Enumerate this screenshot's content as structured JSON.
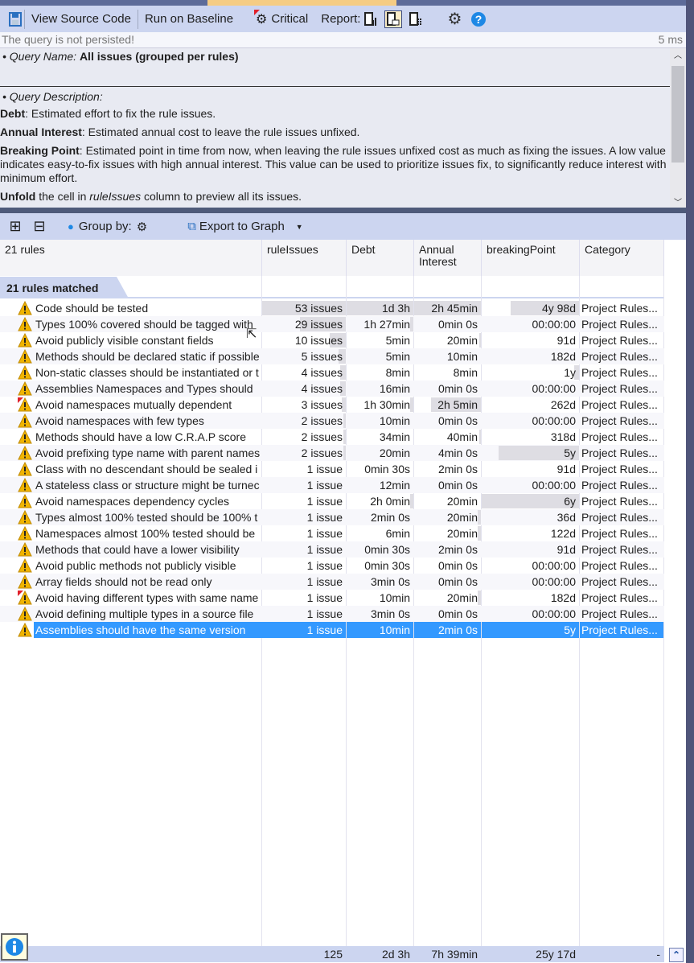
{
  "toolbar": {
    "view_source": "View Source Code",
    "run_baseline": "Run on Baseline",
    "critical": "Critical",
    "report": "Report:"
  },
  "status": {
    "message": "The query is not persisted!",
    "time": "5 ms"
  },
  "description": {
    "query_name_label": "• Query Name:",
    "query_name": "All issues (grouped per rules)",
    "query_desc_label": "• Query Description:",
    "debt_term": "Debt",
    "debt_text": ": Estimated effort to fix the rule issues.",
    "interest_term": "Annual Interest",
    "interest_text": ": Estimated annual cost to leave the rule issues unfixed.",
    "bp_term": "Breaking Point",
    "bp_text": ": Estimated point in time from now, when leaving the rule issues unfixed cost as much as fixing the issues. A low value indicates easy-to-fix issues with high annual interest. This value can be used to prioritize issues fix, to significantly reduce interest with minimum effort.",
    "unfold_term": "Unfold",
    "unfold_text1": " the cell in ",
    "unfold_col": "ruleIssues",
    "unfold_text2": " column to preview all its issues."
  },
  "grid_toolbar": {
    "group_by": "Group by:",
    "export": "Export to Graph"
  },
  "columns": [
    "21 rules",
    "ruleIssues",
    "Debt",
    "Annual Interest",
    "breakingPoint",
    "Category"
  ],
  "group_label": "21 rules matched",
  "rows": [
    {
      "name": "Code should be tested",
      "issues": "53 issues",
      "debt": "1d  3h",
      "interest": "2h  45min",
      "bp": "4y  98d",
      "cat": "Project Rules...",
      "critical": false,
      "bars": [
        1,
        1,
        1,
        0.7
      ]
    },
    {
      "name": "Types 100% covered should be tagged with",
      "issues": "29 issues",
      "debt": "1h  27min",
      "interest": "0min  0s",
      "bp": "00:00:00",
      "cat": "Project Rules...",
      "critical": false,
      "bars": [
        0.55,
        0.05,
        0,
        0
      ]
    },
    {
      "name": "Avoid publicly visible constant fields",
      "issues": "10 issues",
      "debt": "5min",
      "interest": "20min",
      "bp": "91d",
      "cat": "Project Rules...",
      "critical": false,
      "bars": [
        0.19,
        0,
        0.02,
        0
      ]
    },
    {
      "name": "Methods should be declared static if possible",
      "issues": "5 issues",
      "debt": "5min",
      "interest": "10min",
      "bp": "182d",
      "cat": "Project Rules...",
      "critical": false,
      "bars": [
        0.09,
        0,
        0,
        0
      ]
    },
    {
      "name": "Non-static classes should be instantiated or t",
      "issues": "4 issues",
      "debt": "8min",
      "interest": "8min",
      "bp": "1y",
      "cat": "Project Rules...",
      "critical": false,
      "bars": [
        0.07,
        0,
        0,
        0.05
      ]
    },
    {
      "name": "Assemblies Namespaces and Types should",
      "issues": "4 issues",
      "debt": "16min",
      "interest": "0min  0s",
      "bp": "00:00:00",
      "cat": "Project Rules...",
      "critical": false,
      "bars": [
        0.07,
        0,
        0,
        0
      ]
    },
    {
      "name": "Avoid namespaces mutually dependent",
      "issues": "3 issues",
      "debt": "1h  30min",
      "interest": "2h  5min",
      "bp": "262d",
      "cat": "Project Rules...",
      "critical": true,
      "bars": [
        0.05,
        0.05,
        0.75,
        0
      ]
    },
    {
      "name": "Avoid namespaces with few types",
      "issues": "2 issues",
      "debt": "10min",
      "interest": "0min  0s",
      "bp": "00:00:00",
      "cat": "Project Rules...",
      "critical": false,
      "bars": [
        0.03,
        0,
        0,
        0
      ]
    },
    {
      "name": "Methods should have a low C.R.A.P score",
      "issues": "2 issues",
      "debt": "34min",
      "interest": "40min",
      "bp": "318d",
      "cat": "Project Rules...",
      "critical": false,
      "bars": [
        0.03,
        0,
        0.03,
        0
      ]
    },
    {
      "name": "Avoid prefixing type name with parent names",
      "issues": "2 issues",
      "debt": "20min",
      "interest": "4min  0s",
      "bp": "5y",
      "cat": "Project Rules...",
      "critical": false,
      "bars": [
        0.03,
        0,
        0,
        0.83
      ]
    },
    {
      "name": "Class with no descendant should be sealed i",
      "issues": "1 issue",
      "debt": "0min  30s",
      "interest": "2min  0s",
      "bp": "91d",
      "cat": "Project Rules...",
      "critical": false,
      "bars": [
        0,
        0,
        0,
        0
      ]
    },
    {
      "name": "A stateless class or structure might be turnec",
      "issues": "1 issue",
      "debt": "12min",
      "interest": "0min  0s",
      "bp": "00:00:00",
      "cat": "Project Rules...",
      "critical": false,
      "bars": [
        0,
        0,
        0,
        0
      ]
    },
    {
      "name": "Avoid namespaces dependency cycles",
      "issues": "1 issue",
      "debt": "2h  0min",
      "interest": "20min",
      "bp": "6y",
      "cat": "Project Rules...",
      "critical": false,
      "bars": [
        0,
        0.05,
        0,
        1
      ]
    },
    {
      "name": "Types almost 100% tested should be 100% t",
      "issues": "1 issue",
      "debt": "2min  0s",
      "interest": "20min",
      "bp": "36d",
      "cat": "Project Rules...",
      "critical": false,
      "bars": [
        0,
        0,
        0.05,
        0
      ]
    },
    {
      "name": "Namespaces almost 100% tested should be",
      "issues": "1 issue",
      "debt": "6min",
      "interest": "20min",
      "bp": "122d",
      "cat": "Project Rules...",
      "critical": false,
      "bars": [
        0,
        0,
        0.05,
        0
      ]
    },
    {
      "name": "Methods that could have a lower visibility",
      "issues": "1 issue",
      "debt": "0min  30s",
      "interest": "2min  0s",
      "bp": "91d",
      "cat": "Project Rules...",
      "critical": false,
      "bars": [
        0,
        0,
        0,
        0
      ]
    },
    {
      "name": "Avoid public methods not publicly visible",
      "issues": "1 issue",
      "debt": "0min  30s",
      "interest": "0min  0s",
      "bp": "00:00:00",
      "cat": "Project Rules...",
      "critical": false,
      "bars": [
        0,
        0,
        0,
        0
      ]
    },
    {
      "name": "Array fields should not be read only",
      "issues": "1 issue",
      "debt": "3min  0s",
      "interest": "0min  0s",
      "bp": "00:00:00",
      "cat": "Project Rules...",
      "critical": false,
      "bars": [
        0,
        0,
        0,
        0
      ]
    },
    {
      "name": "Avoid having different types with same name",
      "issues": "1 issue",
      "debt": "10min",
      "interest": "20min",
      "bp": "182d",
      "cat": "Project Rules...",
      "critical": true,
      "bars": [
        0,
        0,
        0.05,
        0
      ]
    },
    {
      "name": "Avoid defining multiple types in a source file",
      "issues": "1 issue",
      "debt": "3min  0s",
      "interest": "0min  0s",
      "bp": "00:00:00",
      "cat": "Project Rules...",
      "critical": false,
      "bars": [
        0,
        0,
        0,
        0
      ]
    },
    {
      "name": "Assemblies should have the same version",
      "issues": "1 issue",
      "debt": "10min",
      "interest": "2min  0s",
      "bp": "5y",
      "cat": "Project Rules...",
      "critical": false,
      "bars": [
        0,
        0,
        0,
        0.83
      ],
      "selected": true
    }
  ],
  "totals": {
    "issues": "125",
    "debt": "2d  3h",
    "interest": "7h  39min",
    "bp": "25y  17d",
    "cat": "-"
  }
}
